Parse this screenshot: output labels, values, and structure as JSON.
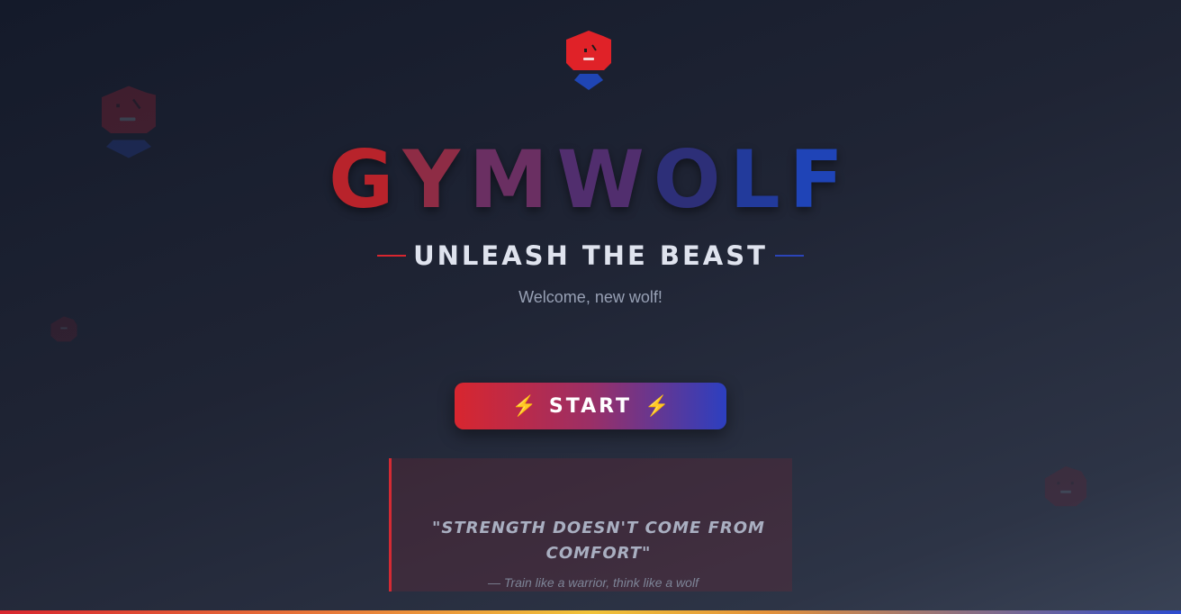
{
  "app": {
    "brand_letters": [
      "G",
      "Y",
      "M",
      "W",
      "O",
      "L",
      "F"
    ],
    "tagline": "UNLEASH THE BEAST",
    "welcome": "Welcome, new wolf!"
  },
  "start_button": {
    "icon_left": "lightning-bolt-icon",
    "label": "START",
    "icon_right": "lightning-bolt-icon",
    "glyph": "⚡"
  },
  "quote": {
    "text": "\"STRENGTH DOESN'T COME FROM COMFORT\"",
    "author": "— Train like a warrior, think like a wolf"
  },
  "icons": {
    "logo": "wolf-mascot-icon",
    "background": "wolf-mascot-icon"
  },
  "colors": {
    "red": "#d8262f",
    "blue": "#2c44c0",
    "brand_gradient": [
      "#b8232b",
      "#8e2c45",
      "#6a2f62",
      "#512e6e",
      "#2d2f78",
      "#223a9b",
      "#1f44b7"
    ]
  }
}
